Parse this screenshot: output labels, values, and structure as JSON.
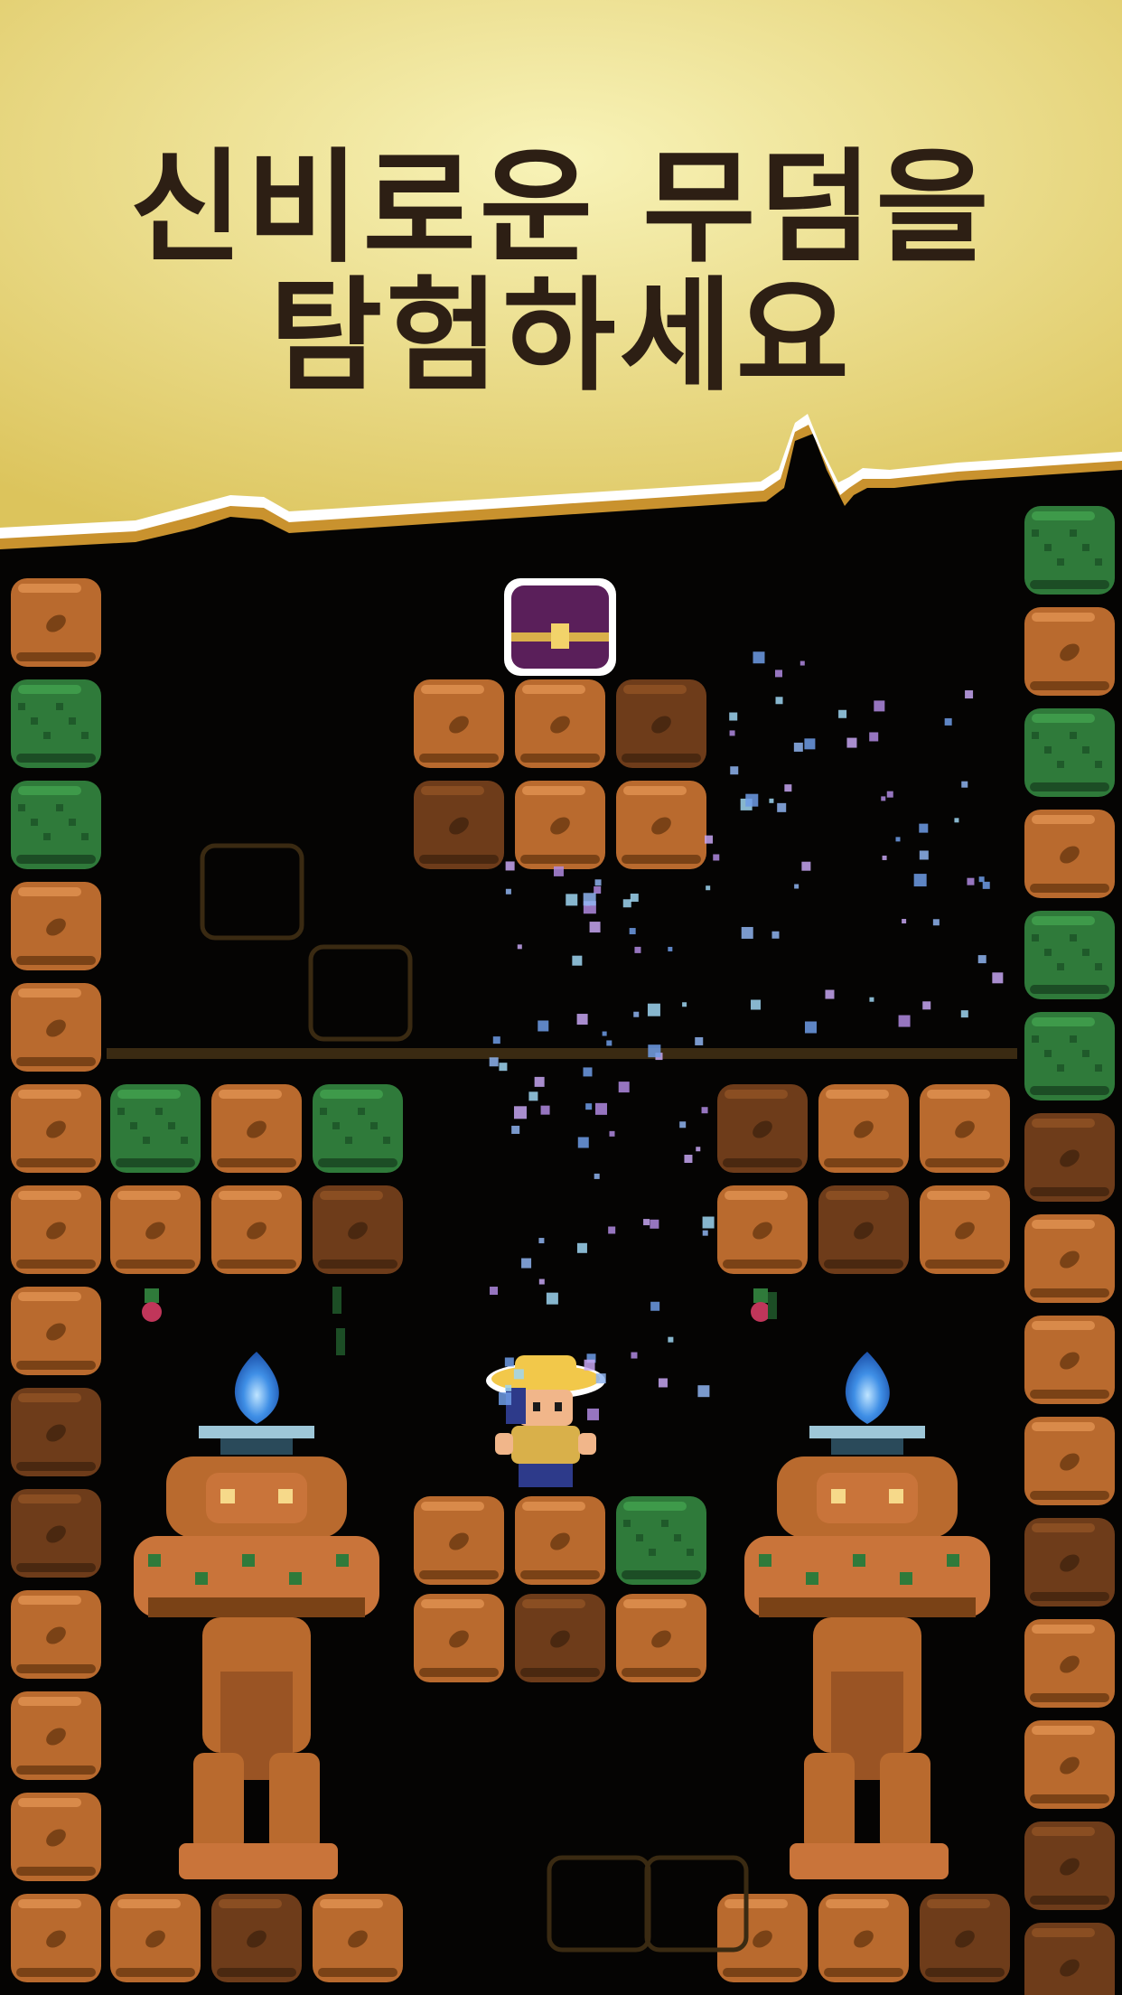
{
  "headline": {
    "line1": "신비로운 무덤을",
    "line2": "탐험하세요"
  },
  "colors": {
    "banner_light": "#f6efa8",
    "banner_dark": "#dcc45c",
    "banner_edge": "#c9922e",
    "text": "#2d1f14",
    "dirt": "#b96a2e",
    "dirt_light": "#d98a4a",
    "dirt_dark": "#6e3c1a",
    "moss": "#2f7a3a",
    "moss_dark": "#1c4d25",
    "flame": "#3f8fe6",
    "sparkle_blue": "#8fb4f0",
    "sparkle_purple": "#b08ae0",
    "chest": "#5a1f5a",
    "background": "#050403"
  },
  "icons": [
    "treasure-chest-icon",
    "explorer-character",
    "blue-flame-icon",
    "golem-statue",
    "berry-icon"
  ]
}
